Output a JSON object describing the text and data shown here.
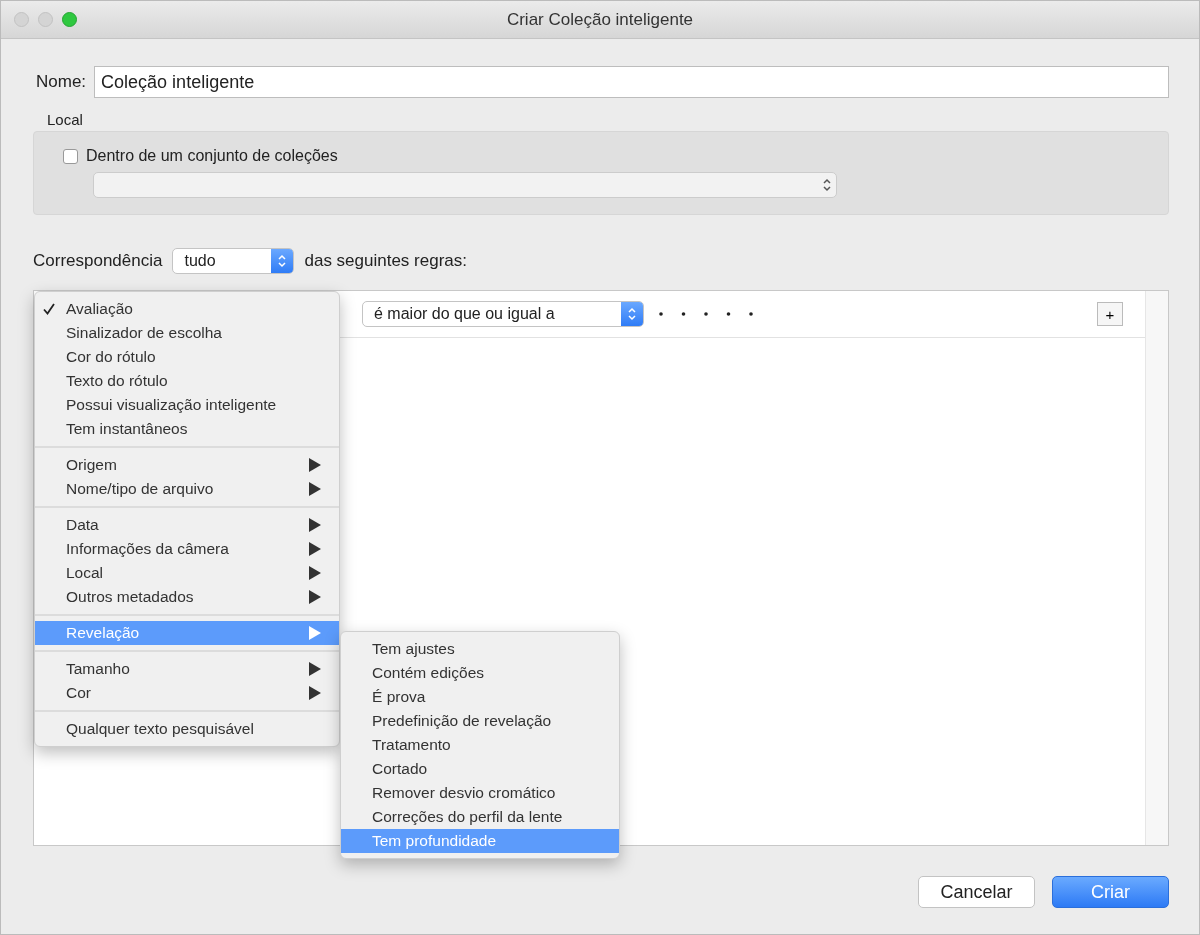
{
  "window": {
    "title": "Criar Coleção inteligente"
  },
  "name_field": {
    "label": "Nome:",
    "value": "Coleção inteligente"
  },
  "location": {
    "label": "Local",
    "checkbox": {
      "label": "Dentro de um conjunto de coleções",
      "checked": false
    }
  },
  "match": {
    "label_before": "Correspondência",
    "value": "tudo",
    "label_after": "das seguintes regras:"
  },
  "rule": {
    "operator": "é maior do que ou igual a",
    "add_button": "+"
  },
  "field_menu": {
    "sections": [
      {
        "items": [
          {
            "label": "Avaliação",
            "checked": true,
            "submenu": false,
            "selected": false
          },
          {
            "label": "Sinalizador de escolha",
            "checked": false,
            "submenu": false,
            "selected": false
          },
          {
            "label": "Cor do rótulo",
            "checked": false,
            "submenu": false,
            "selected": false
          },
          {
            "label": "Texto do rótulo",
            "checked": false,
            "submenu": false,
            "selected": false
          },
          {
            "label": "Possui visualização inteligente",
            "checked": false,
            "submenu": false,
            "selected": false
          },
          {
            "label": "Tem instantâneos",
            "checked": false,
            "submenu": false,
            "selected": false
          }
        ]
      },
      {
        "items": [
          {
            "label": "Origem",
            "checked": false,
            "submenu": true,
            "selected": false
          },
          {
            "label": "Nome/tipo de arquivo",
            "checked": false,
            "submenu": true,
            "selected": false
          }
        ]
      },
      {
        "items": [
          {
            "label": "Data",
            "checked": false,
            "submenu": true,
            "selected": false
          },
          {
            "label": "Informações da câmera",
            "checked": false,
            "submenu": true,
            "selected": false
          },
          {
            "label": "Local",
            "checked": false,
            "submenu": true,
            "selected": false
          },
          {
            "label": "Outros metadados",
            "checked": false,
            "submenu": true,
            "selected": false
          }
        ]
      },
      {
        "items": [
          {
            "label": "Revelação",
            "checked": false,
            "submenu": true,
            "selected": true
          }
        ]
      },
      {
        "items": [
          {
            "label": "Tamanho",
            "checked": false,
            "submenu": true,
            "selected": false
          },
          {
            "label": "Cor",
            "checked": false,
            "submenu": true,
            "selected": false
          }
        ]
      },
      {
        "items": [
          {
            "label": "Qualquer texto pesquisável",
            "checked": false,
            "submenu": false,
            "selected": false
          }
        ]
      }
    ]
  },
  "submenu": {
    "items": [
      {
        "label": "Tem ajustes",
        "selected": false
      },
      {
        "label": "Contém edições",
        "selected": false
      },
      {
        "label": "É prova",
        "selected": false
      },
      {
        "label": "Predefinição de revelação",
        "selected": false
      },
      {
        "label": "Tratamento",
        "selected": false
      },
      {
        "label": "Cortado",
        "selected": false
      },
      {
        "label": "Remover desvio cromático",
        "selected": false
      },
      {
        "label": "Correções do perfil da lente",
        "selected": false
      },
      {
        "label": "Tem profundidade",
        "selected": true
      }
    ]
  },
  "buttons": [
    {
      "label": "Cancelar",
      "default": false
    },
    {
      "label": "Criar",
      "default": true
    }
  ]
}
